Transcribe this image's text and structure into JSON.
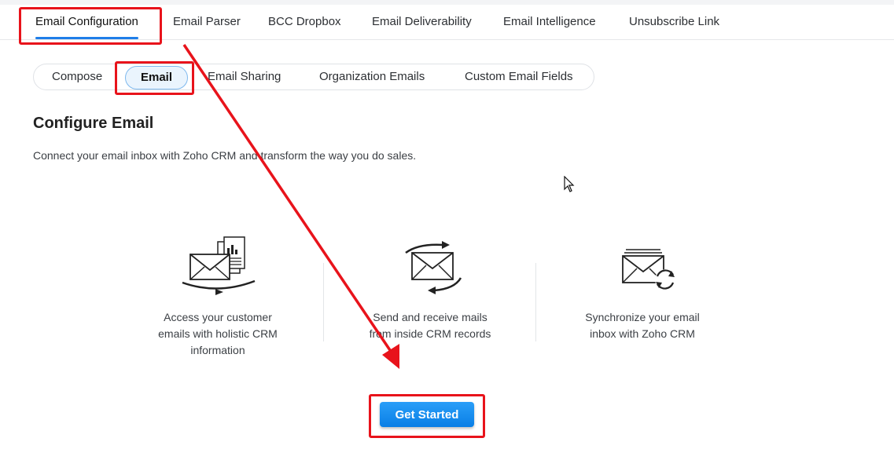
{
  "top_tabs": [
    {
      "label": "Email Configuration"
    },
    {
      "label": "Email Parser"
    },
    {
      "label": "BCC Dropbox"
    },
    {
      "label": "Email Deliverability"
    },
    {
      "label": "Email Intelligence"
    },
    {
      "label": "Unsubscribe Link"
    }
  ],
  "sub_tabs": [
    {
      "label": "Compose"
    },
    {
      "label": "Email"
    },
    {
      "label": "Email Sharing"
    },
    {
      "label": "Organization Emails"
    },
    {
      "label": "Custom Email Fields"
    }
  ],
  "main": {
    "title": "Configure Email",
    "description": "Connect your email inbox with Zoho CRM and transform the way you do sales.",
    "features": [
      {
        "line1": "Access your customer",
        "line2": "emails with holistic CRM",
        "line3": "information",
        "icon": "email-documents-icon"
      },
      {
        "line1": "Send and receive mails",
        "line2": "from inside CRM records",
        "icon": "email-send-receive-icon"
      },
      {
        "line1": "Synchronize your email",
        "line2": "inbox with Zoho CRM",
        "icon": "email-sync-icon"
      }
    ],
    "cta_label": "Get Started"
  },
  "colors": {
    "accent": "#1f7ee8",
    "button": "#0a7fe6",
    "annotation": "#e8131b"
  }
}
